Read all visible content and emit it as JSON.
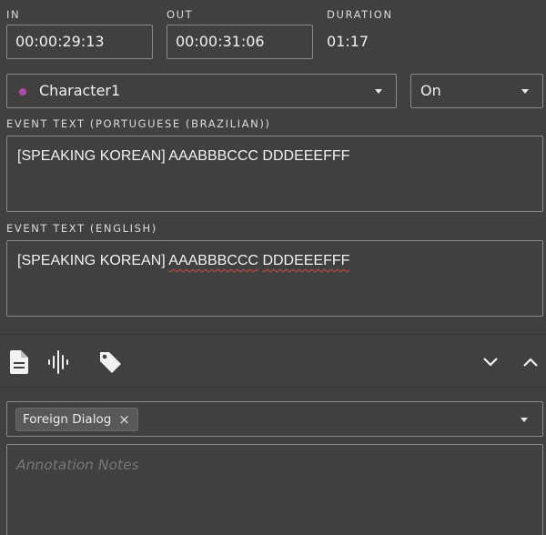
{
  "timing": {
    "in_label": "IN",
    "in_value": "00:00:29:13",
    "out_label": "OUT",
    "out_value": "00:00:31:06",
    "duration_label": "DURATION",
    "duration_value": "01:17"
  },
  "character": {
    "name": "Character1",
    "dot_color": "#b04aa8"
  },
  "toggle": {
    "value": "On"
  },
  "event_text_pt": {
    "label": "EVENT TEXT (PORTUGUESE (BRAZILIAN))",
    "value": "[SPEAKING KOREAN] AAABBBCCC DDDEEEFFF"
  },
  "event_text_en": {
    "label": "EVENT TEXT (ENGLISH)",
    "part1": "[SPEAKING KOREAN] ",
    "part2": "AAABBBCCC",
    "part3": " ",
    "part4": "DDDEEEFFF"
  },
  "toolbar": {
    "icons": [
      "document-icon",
      "waveform-icon",
      "tag-icon",
      "chevron-down-icon",
      "chevron-up-icon"
    ]
  },
  "tags": {
    "chip_label": "Foreign Dialog",
    "chip_remove": "×"
  },
  "notes": {
    "placeholder": "Annotation Notes"
  }
}
